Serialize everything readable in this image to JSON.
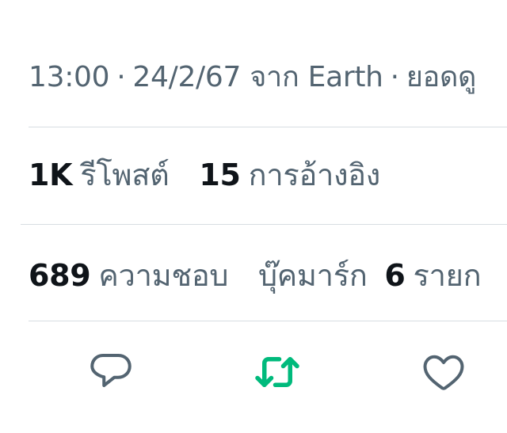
{
  "meta": {
    "time": "13:00",
    "date": "24/2/67",
    "source_prefix": "จาก",
    "source": "Earth",
    "views_label": "ยอดดู",
    "separator": "·"
  },
  "stats": {
    "reposts": {
      "count": "1K",
      "label": "รีโพสต์"
    },
    "quotes": {
      "count": "15",
      "label": "การอ้างอิง"
    },
    "likes": {
      "count": "689",
      "label": "ความชอบ"
    },
    "bookmarks": {
      "label": "บุ๊คมาร์ก"
    },
    "items": {
      "count": "6",
      "label": "รายก"
    }
  },
  "actions": [
    {
      "icon": "reply-icon",
      "color": "#536471"
    },
    {
      "icon": "retweet-icon",
      "color": "#00ba7c",
      "active": true
    },
    {
      "icon": "heart-icon",
      "color": "#536471"
    }
  ],
  "colors": {
    "text_primary": "#0f1419",
    "text_secondary": "#536471",
    "divider": "#d7dde2",
    "retweet_active": "#00ba7c"
  }
}
